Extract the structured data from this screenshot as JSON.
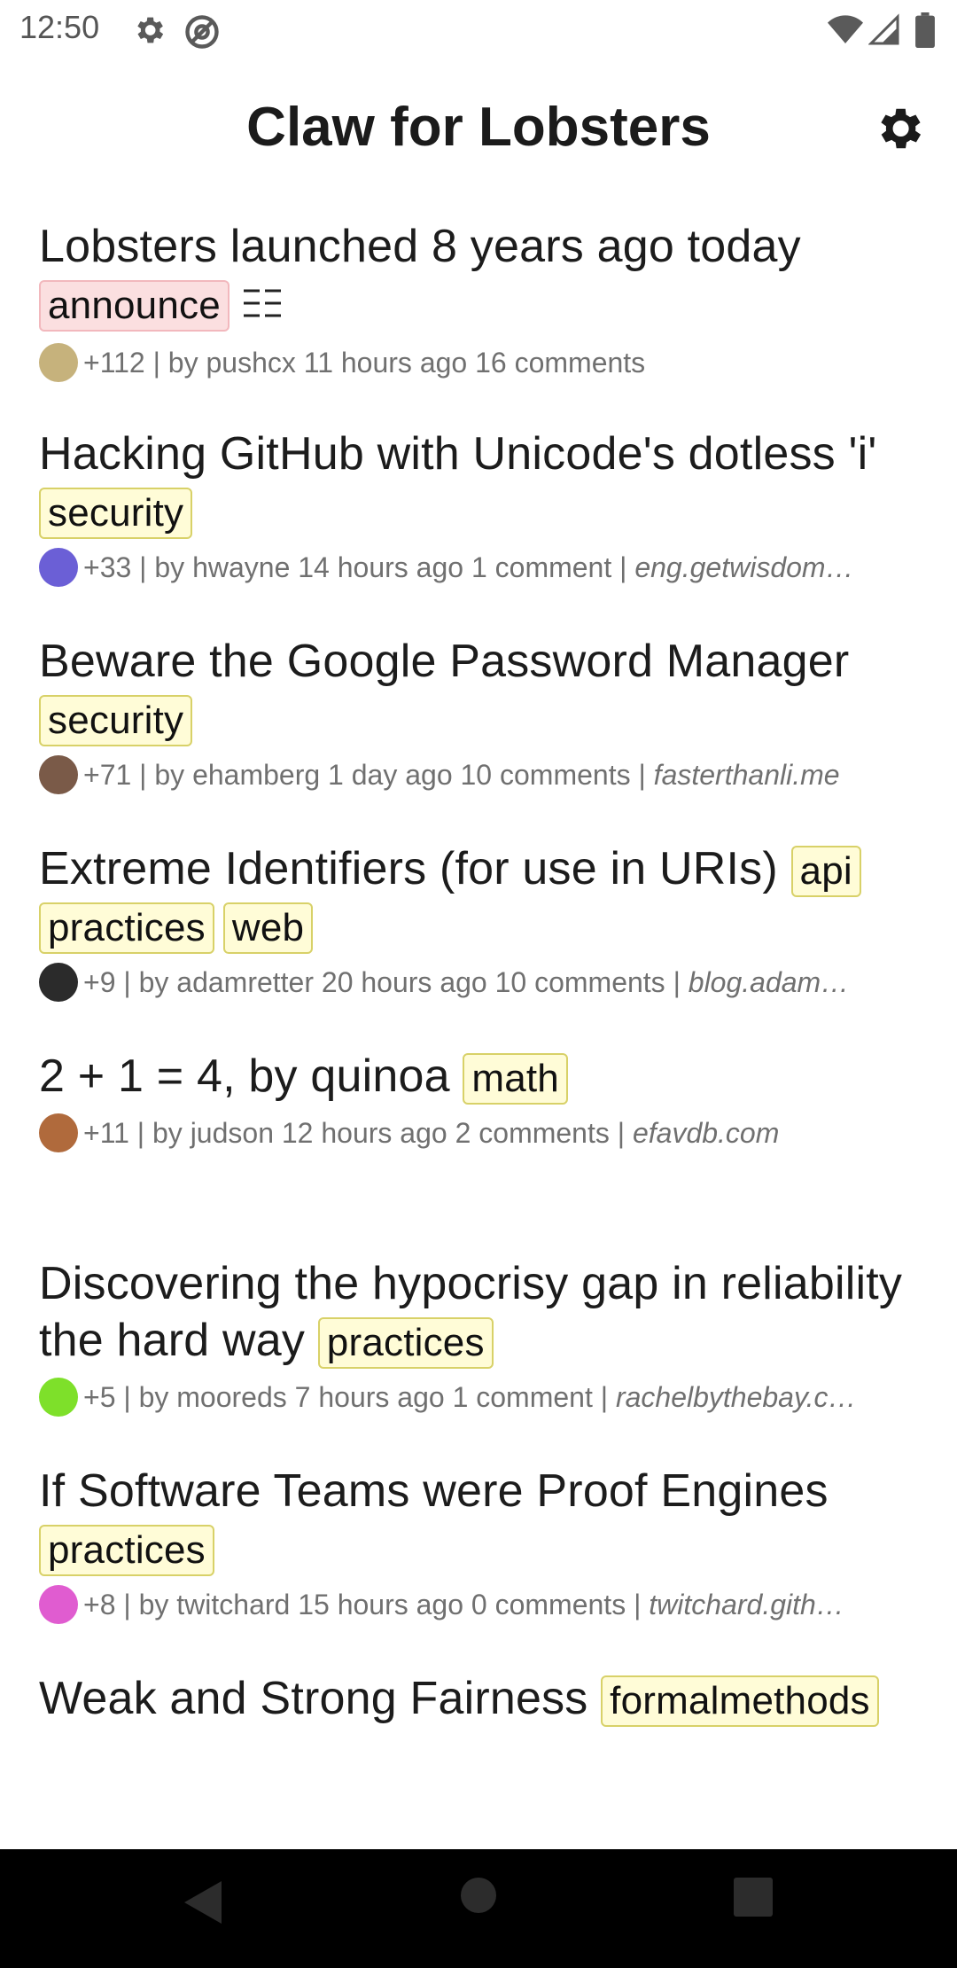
{
  "status_bar": {
    "time": "12:50",
    "left_icons": [
      "gear-icon",
      "at-sign-icon"
    ],
    "right_icons": [
      "wifi-icon",
      "cell-signal-icon",
      "battery-icon"
    ]
  },
  "app_bar": {
    "title": "Claw for Lobsters",
    "settings_icon": "gear-icon"
  },
  "stories": [
    {
      "title": "Lobsters launched 8 years ago today",
      "tags": [
        "announce"
      ],
      "has_text_icon": true,
      "score": "+112",
      "author": "pushcx",
      "age": "11 hours ago",
      "comments": "16 comments",
      "domain": "",
      "avatar_color": "#c6b27c"
    },
    {
      "title": "Hacking GitHub with Unicode's dotless 'i'",
      "tags": [
        "security"
      ],
      "has_text_icon": false,
      "score": "+33",
      "author": "hwayne",
      "age": "14 hours ago",
      "comments": "1 comment",
      "domain": "eng.getwisdom…",
      "avatar_color": "#6b5fd6"
    },
    {
      "title": "Beware the Google Password Manager",
      "tags": [
        "security"
      ],
      "has_text_icon": false,
      "score": "+71",
      "author": "ehamberg",
      "age": "1 day ago",
      "comments": "10 comments",
      "domain": "fasterthanli.me",
      "avatar_color": "#7a5a48"
    },
    {
      "title": "Extreme Identifiers (for use in URIs)",
      "tags": [
        "api",
        "practices",
        "web"
      ],
      "has_text_icon": false,
      "score": "+9",
      "author": "adamretter",
      "age": "20 hours ago",
      "comments": "10 comments",
      "domain": "blog.adam…",
      "avatar_color": "#2b2b2b"
    },
    {
      "title": "2 + 1 = 4, by quinoa",
      "tags": [
        "math"
      ],
      "has_text_icon": false,
      "score": "+11",
      "author": "judson",
      "age": "12 hours ago",
      "comments": "2 comments",
      "domain": "efavdb.com",
      "avatar_color": "#b06a3c"
    },
    {
      "title": "Discovering the hypocrisy gap in reliability the hard way",
      "tags": [
        "practices"
      ],
      "has_text_icon": false,
      "score": "+5",
      "author": "mooreds",
      "age": "7 hours ago",
      "comments": "1 comment",
      "domain": "rachelbythebay.c…",
      "avatar_color": "#7ee02a"
    },
    {
      "title": "If Software Teams were Proof Engines",
      "tags": [
        "practices"
      ],
      "has_text_icon": false,
      "score": "+8",
      "author": "twitchard",
      "age": "15 hours ago",
      "comments": "0 comments",
      "domain": "twitchard.gith…",
      "avatar_color": "#e05cd0"
    },
    {
      "title": "Weak and Strong Fairness",
      "tags": [
        "formalmethods"
      ],
      "has_text_icon": false,
      "score": "",
      "author": "",
      "age": "",
      "comments": "",
      "domain": "",
      "avatar_color": "#999999"
    }
  ],
  "nav_bar": {
    "buttons": [
      "back-icon",
      "home-icon",
      "recents-icon"
    ]
  }
}
